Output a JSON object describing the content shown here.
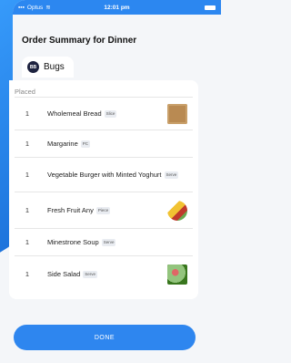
{
  "status_bar": {
    "carrier": "Optus",
    "time": "12:01 pm"
  },
  "title": "Order Summary for Dinner",
  "tab": {
    "initials": "BB",
    "label": "Bugs"
  },
  "section_label": "Placed",
  "items": [
    {
      "qty": "1",
      "name": "Wholemeal Bread",
      "unit": "Slice",
      "image": "bread-icon"
    },
    {
      "qty": "1",
      "name": "Margarine",
      "unit": "PC",
      "image": ""
    },
    {
      "qty": "1",
      "name": "Vegetable Burger with Minted Yoghurt",
      "unit": "Serve",
      "image": ""
    },
    {
      "qty": "1",
      "name": "Fresh Fruit Any",
      "unit": "Piece",
      "image": "fruit-icon"
    },
    {
      "qty": "1",
      "name": "Minestrone Soup",
      "unit": "Serve",
      "image": ""
    },
    {
      "qty": "1",
      "name": "Side Salad",
      "unit": "Serve",
      "image": "salad-icon"
    }
  ],
  "done_label": "DONE",
  "colors": {
    "accent": "#2e86ef",
    "badge": "#1e2340"
  }
}
